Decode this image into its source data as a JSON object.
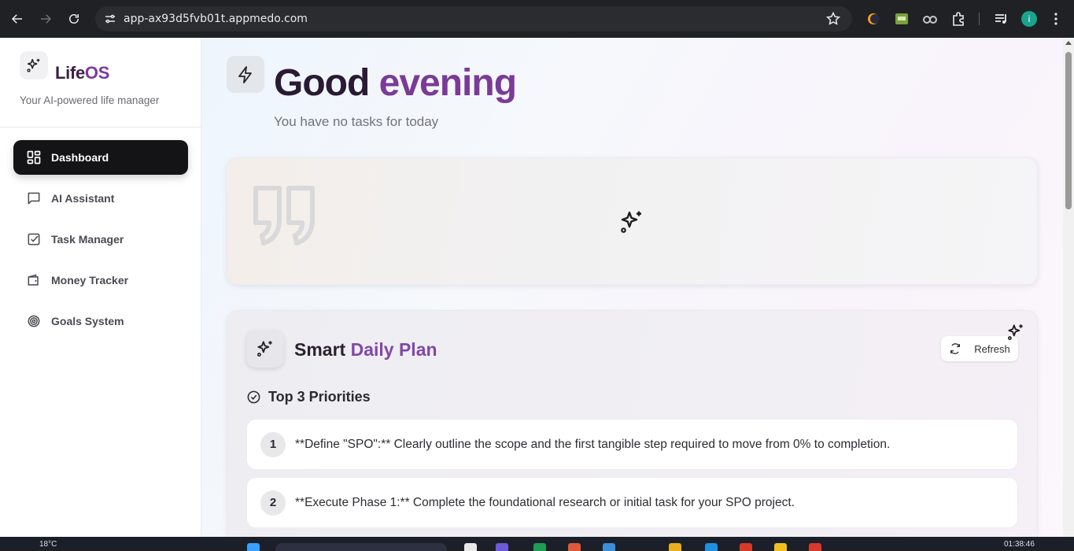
{
  "browser": {
    "url": "app-ax93d5fvb01t.appmedo.com",
    "profile_initial": "i"
  },
  "sidebar": {
    "brand_prefix": "Life",
    "brand_suffix": "OS",
    "tagline": "Your AI-powered life manager",
    "items": [
      {
        "label": "Dashboard",
        "icon": "dashboard-icon",
        "active": true
      },
      {
        "label": "AI Assistant",
        "icon": "chat-icon",
        "active": false
      },
      {
        "label": "Task Manager",
        "icon": "checkbox-icon",
        "active": false
      },
      {
        "label": "Money Tracker",
        "icon": "wallet-icon",
        "active": false
      },
      {
        "label": "Goals System",
        "icon": "target-icon",
        "active": false
      }
    ]
  },
  "header": {
    "greeting_first": "Good",
    "greeting_second": "evening",
    "subtitle": "You have no tasks for today"
  },
  "plan": {
    "title_first": "Smart",
    "title_second": "Daily Plan",
    "refresh_label": "Refresh",
    "priorities_heading": "Top 3 Priorities",
    "priorities": [
      {
        "num": "1",
        "text": "**Define \"SPO\":** Clearly outline the scope and the first tangible step required to move from 0% to completion."
      },
      {
        "num": "2",
        "text": "**Execute Phase 1:** Complete the foundational research or initial task for your SPO project."
      }
    ]
  },
  "taskbar": {
    "weather": "18°C",
    "time": "01:38:46"
  },
  "colors": {
    "accent_purple": "#7a3b96",
    "active_nav_bg": "#141416",
    "chrome_bg": "#202124"
  }
}
